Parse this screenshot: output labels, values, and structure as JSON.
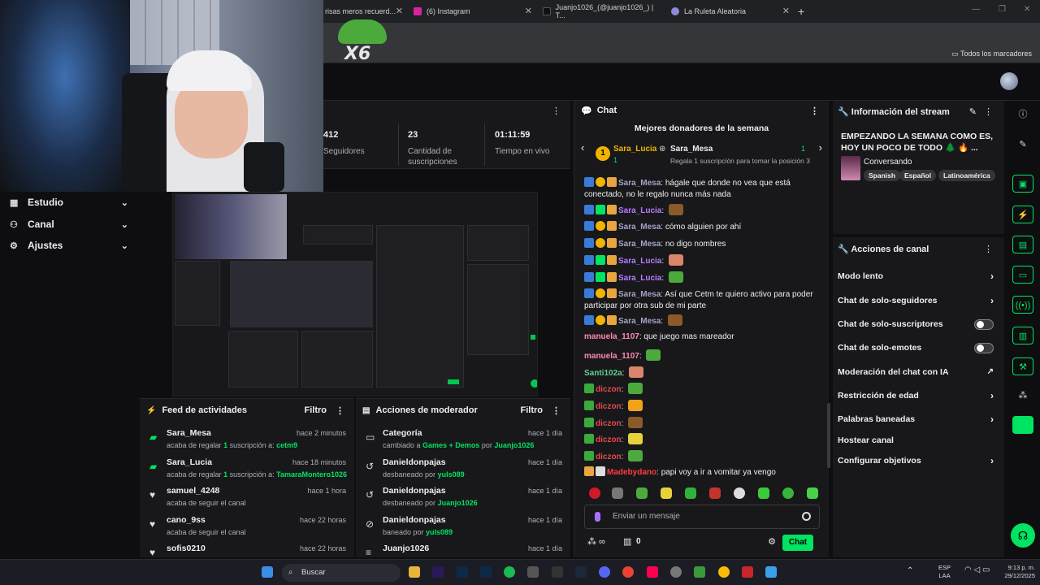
{
  "browser": {
    "tabs": [
      {
        "label": "risas meros recuerd...",
        "fav_color": "#e23b3b"
      },
      {
        "label": "(6) Instagram",
        "fav_color": "#d6249f"
      },
      {
        "label": "Juanjo1026_(@juanjo1026_) | T...",
        "fav_color": "#111111"
      },
      {
        "label": "La Ruleta Aleatoria",
        "fav_color": "#8b8bd8"
      }
    ],
    "bookmarks_label": "Todos los marcadores",
    "overlay_text": "X6"
  },
  "nav": {
    "items": [
      {
        "label": "Estudio",
        "icon": "grid-icon"
      },
      {
        "label": "Canal",
        "icon": "channel-icon"
      },
      {
        "label": "Ajustes",
        "icon": "gear-icon"
      }
    ]
  },
  "stats": {
    "followers_value": "412",
    "followers_label": "Seguidores",
    "subs_value": "23",
    "subs_label": "Cantidad de suscripciones",
    "live_value": "01:11:59",
    "live_label": "Tiempo en vivo"
  },
  "feed": {
    "title": "Feed de actividades",
    "filter": "Filtro",
    "items": [
      {
        "name": "Sara_Mesa",
        "time": "hace 2 minutos",
        "pre": "acaba de regalar ",
        "count": "1",
        "mid": " suscripción a: ",
        "target": "cetm9",
        "icon": "gift-icon"
      },
      {
        "name": "Sara_Lucia",
        "time": "hace 18 minutos",
        "pre": "acaba de regalar ",
        "count": "1",
        "mid": " suscripción a: ",
        "target": "TamaraMontero1026",
        "icon": "gift-icon"
      },
      {
        "name": "samuel_4248",
        "time": "hace 1 hora",
        "pre": "acaba de seguir el canal",
        "count": "",
        "mid": "",
        "target": "",
        "icon": "heart-icon"
      },
      {
        "name": "cano_9ss",
        "time": "hace 22 horas",
        "pre": "acaba de seguir el canal",
        "count": "",
        "mid": "",
        "target": "",
        "icon": "heart-icon"
      },
      {
        "name": "sofis0210",
        "time": "hace 22 horas",
        "pre": "",
        "count": "",
        "mid": "",
        "target": "",
        "icon": "heart-icon"
      }
    ]
  },
  "modactions": {
    "title": "Acciones de moderador",
    "filter": "Filtro",
    "items": [
      {
        "name": "Categoría",
        "time": "hace 1 día",
        "desc1": "cambiado a ",
        "hl": "Games + Demos",
        "desc2": " por ",
        "by": "Juanjo1026"
      },
      {
        "name": "Danieldonpajas",
        "time": "hace 1 día",
        "desc1": "desbaneado por ",
        "hl": "",
        "desc2": "",
        "by": "yuls089"
      },
      {
        "name": "Danieldonpajas",
        "time": "hace 1 día",
        "desc1": "desbaneado por ",
        "hl": "",
        "desc2": "",
        "by": "Juanjo1026"
      },
      {
        "name": "Danieldonpajas",
        "time": "hace 1 día",
        "desc1": "baneado por ",
        "hl": "",
        "desc2": "",
        "by": "yuls089"
      },
      {
        "name": "Juanjo1026",
        "time": "hace 1 día",
        "desc1": "",
        "hl": "",
        "desc2": "",
        "by": ""
      }
    ]
  },
  "chat": {
    "title": "Chat",
    "donors_title": "Mejores donadores de la semana",
    "donor1_name": "Sara_Lucia",
    "donor1_count": "1",
    "donor2_name": "Sara_Mesa",
    "donor2_count": "1",
    "donor2_sub": "Regala 1 suscripción para tomar la posición 3",
    "messages": [
      {
        "user": "Sara_Mesa",
        "cls": "u-sara-m",
        "text": "hágale que donde no vea que está conectado, no le regalo nunca más nada"
      },
      {
        "user": "Sara_Lucia",
        "cls": "u-sara-l",
        "text": ""
      },
      {
        "user": "Sara_Mesa",
        "cls": "u-sara-m",
        "text": "cómo alguien por ahí"
      },
      {
        "user": "Sara_Mesa",
        "cls": "u-sara-m",
        "text": "no digo nombres"
      },
      {
        "user": "Sara_Lucia",
        "cls": "u-sara-l",
        "text": ""
      },
      {
        "user": "Sara_Lucia",
        "cls": "u-sara-l",
        "text": ""
      },
      {
        "user": "Sara_Mesa",
        "cls": "u-sara-m",
        "text": "Así que Cetm te quiero activo para poder participar por otra sub de mi parte"
      },
      {
        "user": "Sara_Mesa",
        "cls": "u-sara-m",
        "text": ""
      },
      {
        "user": "manuela_1107",
        "cls": "u-manu",
        "text": "que juego mas mareador"
      },
      {
        "user": "manuela_1107",
        "cls": "u-manu",
        "text": ""
      },
      {
        "user": "Santi102a",
        "cls": "u-santi",
        "text": ""
      },
      {
        "user": "diczon",
        "cls": "u-dic",
        "text": ""
      },
      {
        "user": "diczon",
        "cls": "u-dic",
        "text": ""
      },
      {
        "user": "diczon",
        "cls": "u-dic",
        "text": ""
      },
      {
        "user": "diczon",
        "cls": "u-dic",
        "text": ""
      },
      {
        "user": "diczon",
        "cls": "u-dic",
        "text": ""
      },
      {
        "user": "Madebydano",
        "cls": "u-made",
        "text": "papi voy a ir a vomitar ya vengo"
      }
    ],
    "input_placeholder": "Enviar un mensaje",
    "points_value": "0",
    "send_label": "Chat"
  },
  "stream_info": {
    "title": "Información del stream",
    "stream_title": "EMPEZANDO LA SEMANA COMO ES, HOY UN POCO DE TODO 🌲 🔥 ...",
    "category": "Conversando",
    "tags": [
      "Spanish",
      "Español",
      "Latinoamérica"
    ]
  },
  "channel_actions": {
    "title": "Acciones de canal",
    "items": [
      {
        "label": "Modo lento",
        "control": "chevron"
      },
      {
        "label": "Chat de solo-seguidores",
        "control": "chevron"
      },
      {
        "label": "Chat de solo-suscriptores",
        "control": "toggle"
      },
      {
        "label": "Chat de solo-emotes",
        "control": "toggle"
      },
      {
        "label": "Moderación del chat con IA",
        "control": "external"
      },
      {
        "label": "Restricción de edad",
        "control": "chevron"
      },
      {
        "label": "Palabras baneadas",
        "control": "chevron"
      },
      {
        "label": "Hostear canal",
        "control": "none"
      },
      {
        "label": "Configurar objetivos",
        "control": "chevron"
      }
    ]
  },
  "taskbar": {
    "search_label": "Buscar",
    "lang_top": "ESP",
    "lang_bottom": "LAA",
    "time": "9:13 p. m.",
    "date": "29/12/2025"
  },
  "colors": {
    "accent_green": "#00e461",
    "panel_bg": "#18181b",
    "page_bg": "#0e0e10"
  }
}
